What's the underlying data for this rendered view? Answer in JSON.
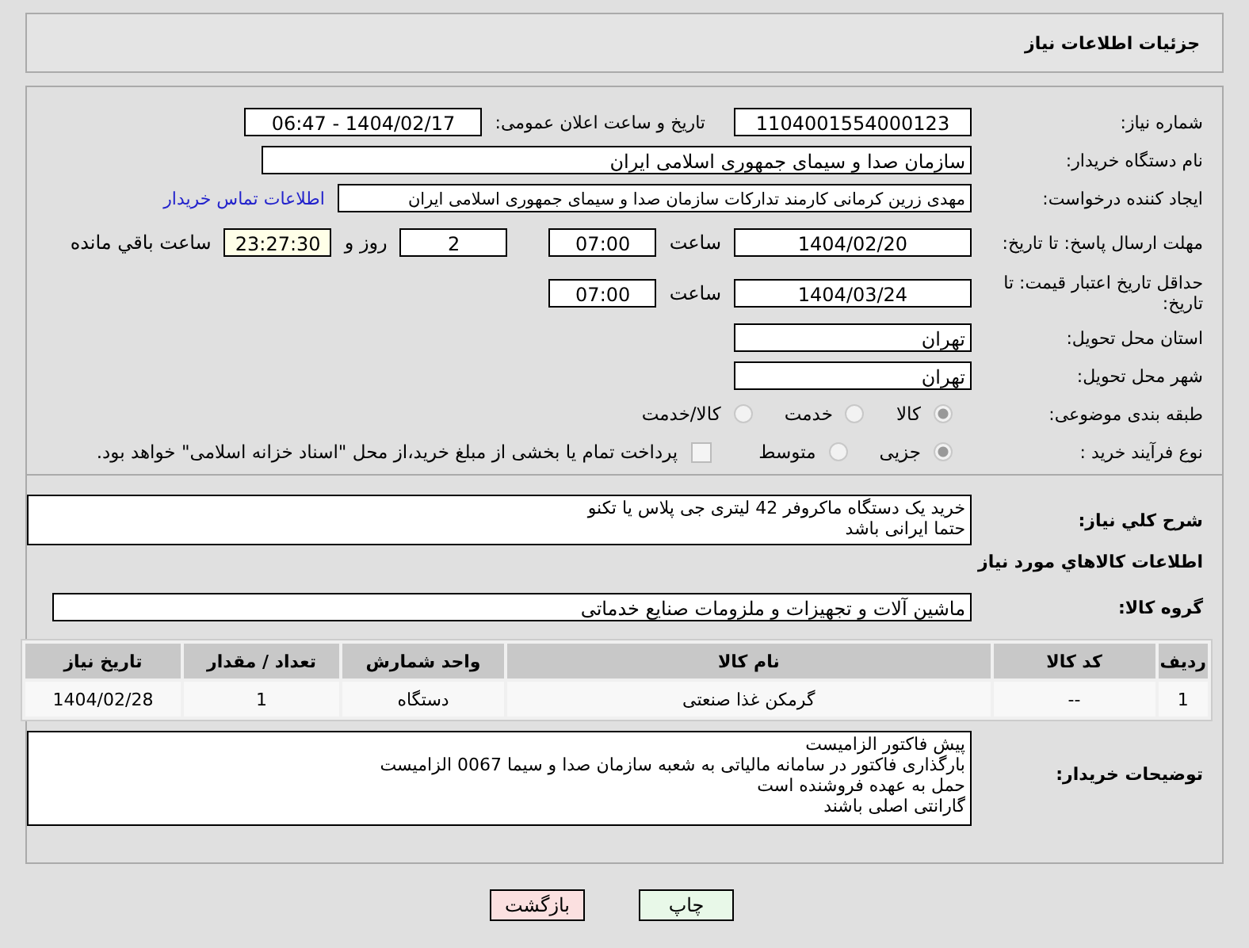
{
  "header": {
    "title": "جزئیات اطلاعات نیاز"
  },
  "need_number": {
    "label": "شماره نیاز:",
    "value": "1104001554000123"
  },
  "announce": {
    "label": "تاریخ و ساعت اعلان عمومی:",
    "value": "1404/02/17 - 06:47"
  },
  "buyer_org": {
    "label": "نام دستگاه خریدار:",
    "value": "سازمان صدا و سیمای جمهوری اسلامی ایران"
  },
  "creator": {
    "label": "ایجاد کننده درخواست:",
    "value": "مهدی زرین کرمانی کارمند تدارکات سازمان صدا و سیمای جمهوری اسلامی ایران",
    "link": "اطلاعات تماس خریدار"
  },
  "deadline": {
    "label": "مهلت ارسال پاسخ: تا تاریخ:",
    "date": "1404/02/20",
    "time_label": "ساعت",
    "time": "07:00",
    "days": "2",
    "days_label": "روز و",
    "remaining": "23:27:30",
    "remaining_label": "ساعت باقي مانده"
  },
  "validity": {
    "label": "حداقل تاریخ اعتبار قیمت: تا تاریخ:",
    "date": "1404/03/24",
    "time_label": "ساعت",
    "time": "07:00"
  },
  "province": {
    "label": "استان محل تحویل:",
    "value": "تهران"
  },
  "city": {
    "label": "شهر محل تحویل:",
    "value": "تهران"
  },
  "category": {
    "label": "طبقه بندی موضوعی:",
    "options": [
      {
        "label": "كالا",
        "selected": true
      },
      {
        "label": "خدمت",
        "selected": false
      },
      {
        "label": "كالا/خدمت",
        "selected": false
      }
    ]
  },
  "process": {
    "label": "نوع فرآیند خرید :",
    "options": [
      {
        "label": "جزیی",
        "selected": true
      },
      {
        "label": "متوسط",
        "selected": false
      }
    ],
    "payment": {
      "label": "پرداخت تمام یا بخشی از مبلغ خرید،از محل \"اسناد خزانه اسلامی\" خواهد بود.",
      "checked": false
    }
  },
  "description": {
    "label": "شرح كلي نياز:",
    "lines": [
      "خرید یک دستگاه ماکروفر 42 لیتری جی پلاس یا تکنو",
      "حتما ایرانی باشد"
    ]
  },
  "goods_heading": "اطلاعات كالاهاي مورد نياز",
  "goods_group": {
    "label": "گروه کالا:",
    "value": "ماشین آلات و تجهیزات و ملزومات صنایع خدماتی"
  },
  "table": {
    "columns": [
      "ردیف",
      "کد کالا",
      "نام کالا",
      "واحد شمارش",
      "تعداد / مقدار",
      "تاریخ نیاز"
    ],
    "rows": [
      [
        "1",
        "--",
        "گرمکن غذا صنعتی",
        "دستگاه",
        "1",
        "1404/02/28"
      ]
    ]
  },
  "buyer_notes": {
    "label": "توضیحات خریدار:",
    "lines": [
      "پیش فاکتور الزامیست",
      "بارگذاری فاکتور در سامانه مالیاتی به شعبه سازمان صدا و سیما 0067 الزامیست",
      "حمل به عهده فروشنده است",
      "گارانتی اصلی باشند"
    ]
  },
  "buttons": [
    {
      "label": "چاپ",
      "kind": "print"
    },
    {
      "label": "بازگشت",
      "kind": "back"
    }
  ]
}
